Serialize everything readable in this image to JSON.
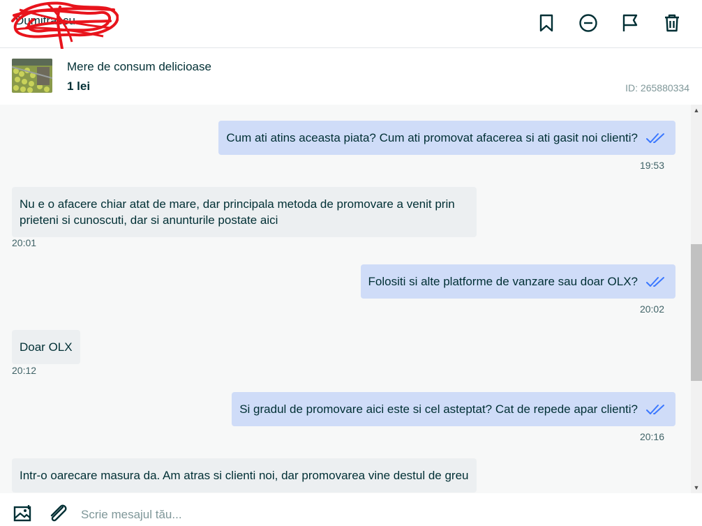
{
  "header": {
    "user_name": "Dumitrascu",
    "actions": [
      {
        "name": "bookmark-icon",
        "label": "Save"
      },
      {
        "name": "block-icon",
        "label": "Block"
      },
      {
        "name": "flag-icon",
        "label": "Report"
      },
      {
        "name": "trash-icon",
        "label": "Delete"
      }
    ]
  },
  "ad": {
    "title": "Mere de consum delicioase",
    "price": "1 lei",
    "id_text": "ID: 265880334"
  },
  "messages": [
    {
      "direction": "out",
      "text": "Cum ati atins aceasta piata? Cum ati promovat afacerea si ati gasit noi clienti?",
      "time": "19:53",
      "read": true
    },
    {
      "direction": "in",
      "text": "Nu e o afacere chiar atat de mare, dar principala metoda de promovare a venit prin prieteni si cunoscuti, dar si anunturile postate aici",
      "time": "20:01"
    },
    {
      "direction": "out",
      "text": "Folositi si alte platforme de vanzare sau doar OLX?",
      "time": "20:02",
      "read": true
    },
    {
      "direction": "in",
      "text": "Doar OLX",
      "time": "20:12"
    },
    {
      "direction": "out",
      "text": "Si gradul de promovare aici este si cel asteptat? Cat de repede apar clienti?",
      "time": "20:16",
      "read": true
    },
    {
      "direction": "in",
      "text": "Intr-o oarecare masura da. Am atras si clienti noi, dar promovarea vine destul de greu",
      "time": ""
    }
  ],
  "composer": {
    "placeholder": "Scrie mesajul tău..."
  },
  "colors": {
    "outgoing_bubble": "#cfdcf8",
    "incoming_bubble": "#eceff1",
    "read_ticks": "#3a77ff",
    "text": "#002f34"
  }
}
